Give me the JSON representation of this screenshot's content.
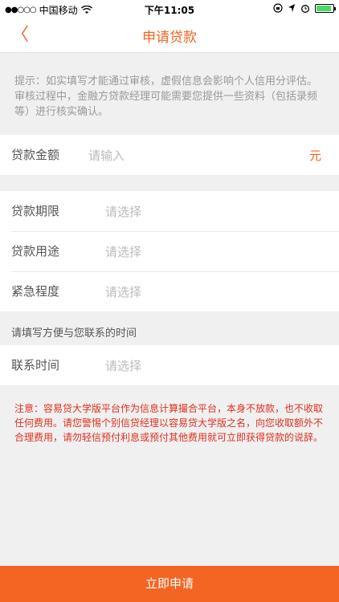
{
  "status_bar": {
    "carrier": "中国移动",
    "time": "下午11:05"
  },
  "nav": {
    "title": "申请贷款",
    "back_glyph": "〈"
  },
  "notice": "提示：如实填写才能通过审核，虚假信息会影响个人信用分评估。审核过程中，金融方贷款经理可能需要您提供一些资料（包括录频等）进行核实确认。",
  "amount": {
    "label": "贷款金额",
    "placeholder": "请输入",
    "unit": "元"
  },
  "loan_fields": [
    {
      "label": "贷款期限",
      "placeholder": "请选择"
    },
    {
      "label": "贷款用途",
      "placeholder": "请选择"
    },
    {
      "label": "紧急程度",
      "placeholder": "请选择"
    }
  ],
  "contact": {
    "section_title": "请填写方便与您联系的时间",
    "label": "联系时间",
    "placeholder": "请选择"
  },
  "warning": "注意：容易贷大学版平台作为信息计算撮合平台，本身不放款，也不收取任何费用。请您警惕个别信贷经理以容易贷大学版之名，向您收取额外不合理费用，请勿轻信预付利息或预付其他费用就可立即获得贷款的说辞。",
  "submit_label": "立即申请"
}
